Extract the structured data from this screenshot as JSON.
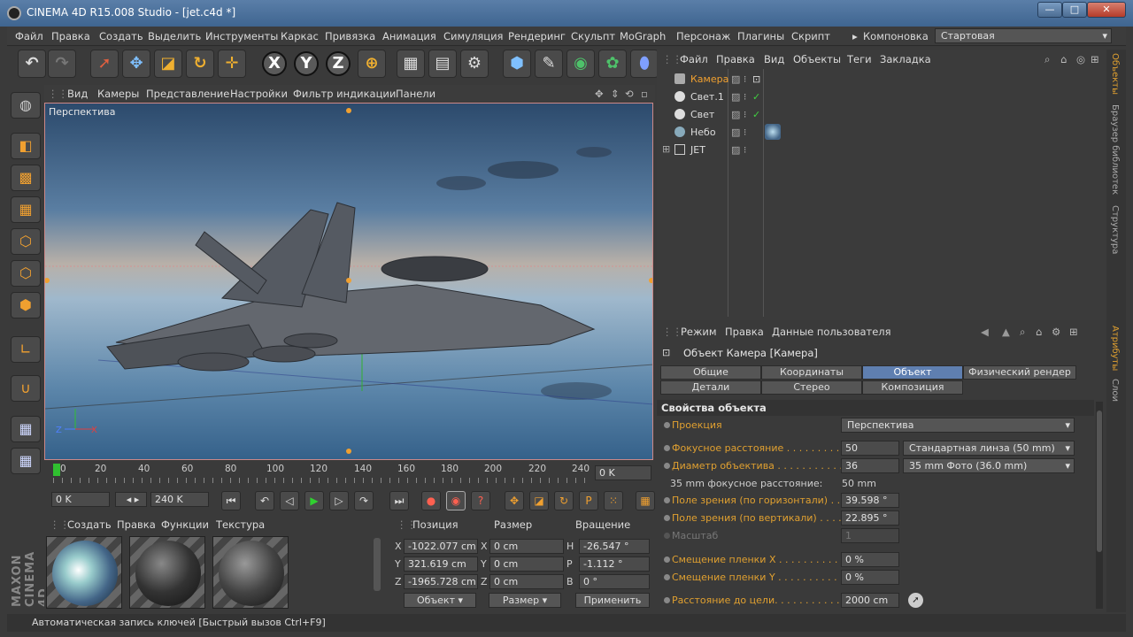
{
  "window": {
    "title": "CINEMA 4D R15.008 Studio - [jet.c4d *]",
    "min": "—",
    "max": "□",
    "close": "✕"
  },
  "menu": [
    "Файл",
    "Правка",
    "Создать",
    "Выделить",
    "Инструменты",
    "Каркас",
    "Привязка",
    "Анимация",
    "Симуляция",
    "Рендеринг",
    "Скульпт",
    "MoGraph",
    "Персонаж",
    "Плагины",
    "Скрипт"
  ],
  "layout": {
    "label": "Компоновка",
    "value": "Стартовая"
  },
  "viewport": {
    "menu": [
      "Вид",
      "Камеры",
      "Представление",
      "Настройки",
      "Фильтр индикации",
      "Панели"
    ],
    "label": "Перспектива"
  },
  "timeline": {
    "ticks": [
      "0",
      "20",
      "40",
      "60",
      "80",
      "100",
      "120",
      "140",
      "160",
      "180",
      "200",
      "220",
      "240"
    ],
    "current": "0 K"
  },
  "transport": {
    "start": "0 K",
    "end": "240 K"
  },
  "materials": {
    "menu": [
      "Создать",
      "Правка",
      "Функции",
      "Текстура"
    ]
  },
  "coords": {
    "headers": [
      "Позиция",
      "Размер",
      "Вращение"
    ],
    "rows": [
      {
        "axis": "X",
        "pos": "-1022.077 cm",
        "size_axis": "X",
        "size": "0 cm",
        "rot_axis": "H",
        "rot": "-26.547 °"
      },
      {
        "axis": "Y",
        "pos": "321.619 cm",
        "size_axis": "Y",
        "size": "0 cm",
        "rot_axis": "P",
        "rot": "-1.112 °"
      },
      {
        "axis": "Z",
        "pos": "-1965.728 cm",
        "size_axis": "Z",
        "size": "0 cm",
        "rot_axis": "B",
        "rot": "0 °"
      }
    ],
    "mode1": "Объект",
    "mode2": "Размер",
    "apply": "Применить"
  },
  "objects": {
    "menu": [
      "Файл",
      "Правка",
      "Вид",
      "Объекты",
      "Теги",
      "Закладка"
    ],
    "items": [
      {
        "name": "Камера",
        "color": "#f0a030"
      },
      {
        "name": "Свет.1",
        "color": "#dddddd"
      },
      {
        "name": "Свет",
        "color": "#dddddd"
      },
      {
        "name": "Небо",
        "color": "#dddddd"
      },
      {
        "name": "JET",
        "color": "#dddddd"
      }
    ]
  },
  "attributes": {
    "menu": [
      "Режим",
      "Правка",
      "Данные пользователя"
    ],
    "object_title": "Объект Камера [Камера]",
    "tabs_row1": [
      "Общие",
      "Координаты",
      "Объект",
      "Физический рендер"
    ],
    "tabs_row2": [
      "Детали",
      "Стерео",
      "Композиция"
    ],
    "section": "Свойства объекта",
    "props": {
      "projection_label": "Проекция",
      "projection": "Перспектива",
      "focal_label": "Фокусное расстояние . . . . . . . . .",
      "focal": "50",
      "focal_preset": "Стандартная линза (50 mm)",
      "aperture_label": "Диаметр объектива . . . . . . . . . . .",
      "aperture": "36",
      "aperture_preset": "35 mm Фото (36.0 mm)",
      "equiv_label": "35 mm фокусное расстояние:",
      "equiv": "50 mm",
      "fovh_label": "Поле зрения (по горизонтали) . . . .",
      "fovh": "39.598 °",
      "fovv_label": "Поле зрения (по вертикали) . . . . .",
      "fovv": "22.895 °",
      "zoom_label": "Масштаб",
      "zoom": "1",
      "shiftx_label": "Смещение пленки X . . . . . . . . . . . .",
      "shiftx": "0 %",
      "shifty_label": "Смещение пленки Y . . . . . . . . . . . .",
      "shifty": "0 %",
      "target_label": "Расстояние до цели. . . . . . . . . . . .",
      "target": "2000 cm"
    }
  },
  "sidestrip": [
    "Объекты",
    "Браузер библиотек",
    "Структура",
    "Атрибуты",
    "Слои"
  ],
  "status": "Автоматическая запись ключей [Быстрый вызов Ctrl+F9]",
  "brand": "MAXON CINEMA 4D"
}
